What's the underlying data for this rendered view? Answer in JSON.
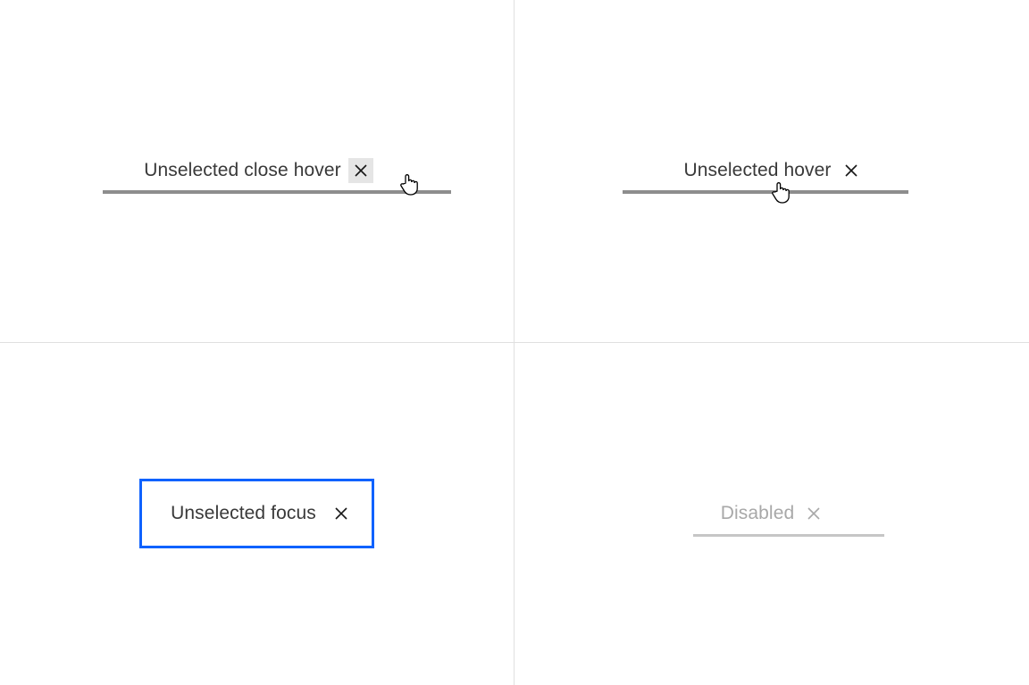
{
  "tabs": {
    "close_hover": {
      "label": "Unselected close hover"
    },
    "hover": {
      "label": "Unselected hover"
    },
    "focus": {
      "label": "Unselected focus"
    },
    "disabled": {
      "label": "Disabled"
    }
  },
  "colors": {
    "focus_ring": "#0f62fe",
    "underline": "#8d8d8d",
    "underline_disabled": "#c6c6c6",
    "close_hover_bg": "#e5e5e5",
    "text": "#393939",
    "text_disabled": "#a8a8a8"
  }
}
